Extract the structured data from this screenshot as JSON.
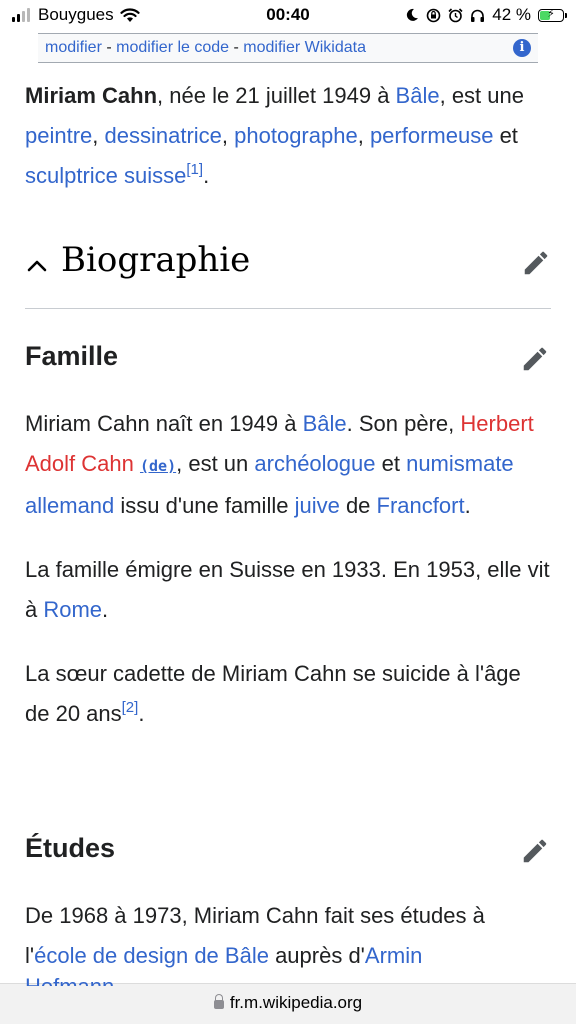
{
  "status_bar": {
    "carrier": "Bouygues",
    "time": "00:40",
    "battery_percent": "42 %",
    "battery_level": 0.42
  },
  "edit_links": {
    "modifier": "modifier",
    "sep1": " - ",
    "modifier_code": "modifier le code",
    "sep2": " - ",
    "modifier_wikidata": "modifier Wikidata",
    "info_icon": "i"
  },
  "intro": {
    "name": "Miriam Cahn",
    "t1": ", née le 21 juillet 1949 à ",
    "bale": "Bâle",
    "t2": ", est une ",
    "peintre": "peintre",
    "c1": ", ",
    "dessinatrice": "dessinatrice",
    "c2": ", ",
    "photographe": "photographe",
    "c3": ", ",
    "performeuse": "performeuse",
    "et": " et ",
    "sculptrice": "sculptrice suisse",
    "ref1": "[1]",
    "end": "."
  },
  "section_biographie": {
    "title": "Biographie"
  },
  "famille": {
    "heading": "Famille",
    "p1": {
      "t1": "Miriam Cahn naît en 1949 à ",
      "bale": "Bâle",
      "t2": ". Son père, ",
      "herbert": "Herbert Adolf Cahn",
      "de": "(de)",
      "t3": ", est un ",
      "archeologue": "archéologue",
      "t4": " et ",
      "numismate": "numismate",
      "t5": " ",
      "allemand": "allemand",
      "t6": " issu d'une famille ",
      "juive": "juive",
      "t7": " de ",
      "francfort": "Francfort",
      "t8": "."
    },
    "p2": {
      "t1": "La famille émigre en Suisse en 1933. En 1953, elle vit à ",
      "rome": "Rome",
      "t2": "."
    },
    "p3": {
      "t1": "La sœur cadette de Miriam Cahn se suicide à l'âge de 20 ans",
      "ref2": "[2]",
      "t2": "."
    }
  },
  "etudes": {
    "heading": "Études",
    "p1": {
      "t1": "De 1968 à 1973, Miriam Cahn fait ses études à l'",
      "ecole": "école de design de Bâle",
      "t2": " auprès d'",
      "armin": "Armin",
      "t3": ""
    },
    "partial_next_line": "Hofmann"
  },
  "browser": {
    "url": "fr.m.wikipedia.org"
  },
  "colors": {
    "link": "#3366cc",
    "redlink": "#dd3333",
    "text": "#202122"
  }
}
